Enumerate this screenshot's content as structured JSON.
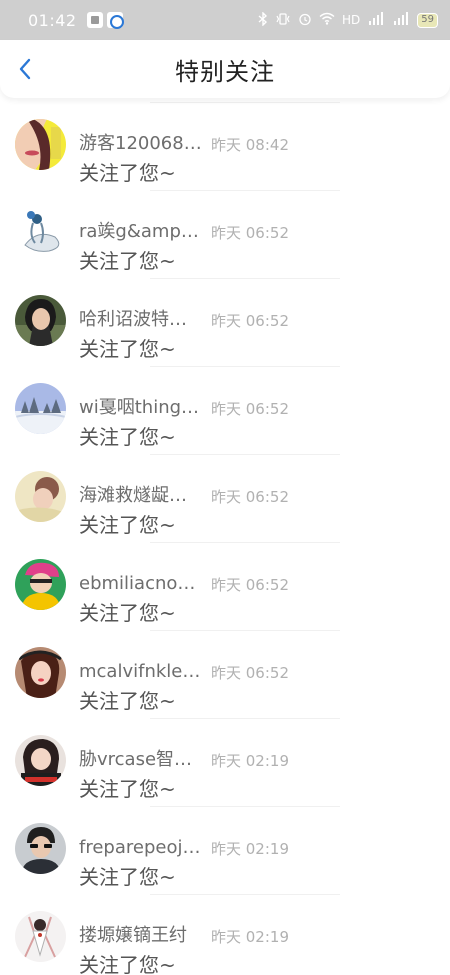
{
  "status_bar": {
    "time": "01:42",
    "network": "HD",
    "signal1": "4G",
    "signal2": "4G",
    "battery": "59"
  },
  "header": {
    "title": "特别关注",
    "back_icon": "chevron-left-icon"
  },
  "colors": {
    "accent": "#2b78d6",
    "status_bar_bg": "#cfcfcf"
  },
  "items": [
    {
      "name": "游客120068…",
      "time": "昨天 08:42",
      "message": "关注了您~"
    },
    {
      "name": "ra竢g&amp;…",
      "time": "昨天 06:52",
      "message": "关注了您~"
    },
    {
      "name": "哈利诏波特…",
      "time": "昨天 06:52",
      "message": "关注了您~"
    },
    {
      "name": "wi戛咽thing…",
      "time": "昨天 06:52",
      "message": "关注了您~"
    },
    {
      "name": "海滩救燧龊…",
      "time": "昨天 06:52",
      "message": "关注了您~"
    },
    {
      "name": "ebmiliacno…",
      "time": "昨天 06:52",
      "message": "关注了您~"
    },
    {
      "name": "mcalvifnklei…",
      "time": "昨天 06:52",
      "message": "关注了您~"
    },
    {
      "name": "胁vrcase智…",
      "time": "昨天 02:19",
      "message": "关注了您~"
    },
    {
      "name": "freparepeoj…",
      "time": "昨天 02:19",
      "message": "关注了您~"
    },
    {
      "name": "搂塬嬢镝王纣",
      "time": "昨天 02:19",
      "message": "关注了您~"
    }
  ]
}
